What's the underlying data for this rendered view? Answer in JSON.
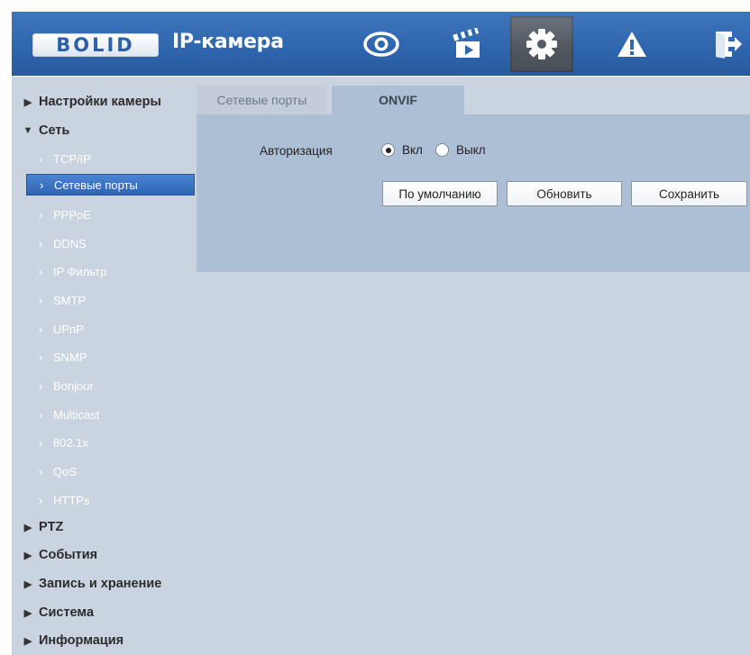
{
  "header": {
    "logo": "BOLID",
    "title": "IP-камера",
    "nav_icons": [
      "eye-icon",
      "clapperboard-icon",
      "gear-icon",
      "warning-icon",
      "exit-icon"
    ],
    "active_nav": "gear-icon",
    "colors": {
      "header_blue": "#2f66ae",
      "active_button": "#51575f",
      "accent": "#2e65b3"
    }
  },
  "sidebar": {
    "groups": {
      "camera_settings": "Настройки камеры",
      "network": "Сеть",
      "ptz": "PTZ",
      "events": "События",
      "storage": "Запись и хранение",
      "system": "Система",
      "info": "Информация"
    },
    "network_items": [
      "TCP/IP",
      "Сетевые порты",
      "PPPoE",
      "DDNS",
      "IP Фильтр",
      "SMTP",
      "UPnP",
      "SNMP",
      "Bonjour",
      "Multicast",
      "802.1x",
      "QoS",
      "HTTPs"
    ],
    "selected_item": "Сетевые порты"
  },
  "content": {
    "tabs": [
      "Сетевые порты",
      "ONVIF"
    ],
    "active_tab": "ONVIF",
    "auth_label": "Авторизация",
    "radio_on": "Вкл",
    "radio_off": "Выкл",
    "radio_selected": "Вкл",
    "buttons": {
      "default": "По умолчанию",
      "refresh": "Обновить",
      "save": "Сохранить"
    }
  }
}
